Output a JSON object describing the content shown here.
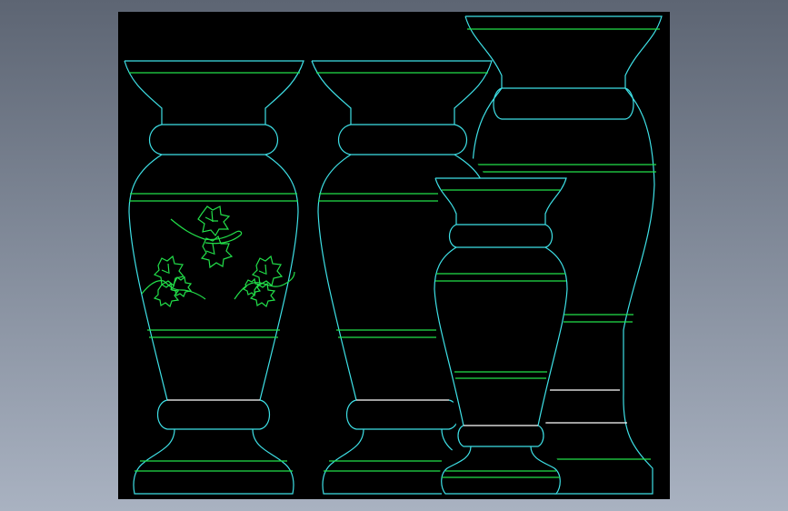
{
  "viewport": {
    "background": "#000000",
    "outline_color": "#3ee0e6",
    "band_color": "#22e04a",
    "accent_color": "#ffffff"
  },
  "drawing": {
    "objects": [
      "ornamented-vase",
      "plain-vase",
      "tall-vase",
      "small-vase"
    ],
    "decoration": "ivy-leaf motif"
  }
}
